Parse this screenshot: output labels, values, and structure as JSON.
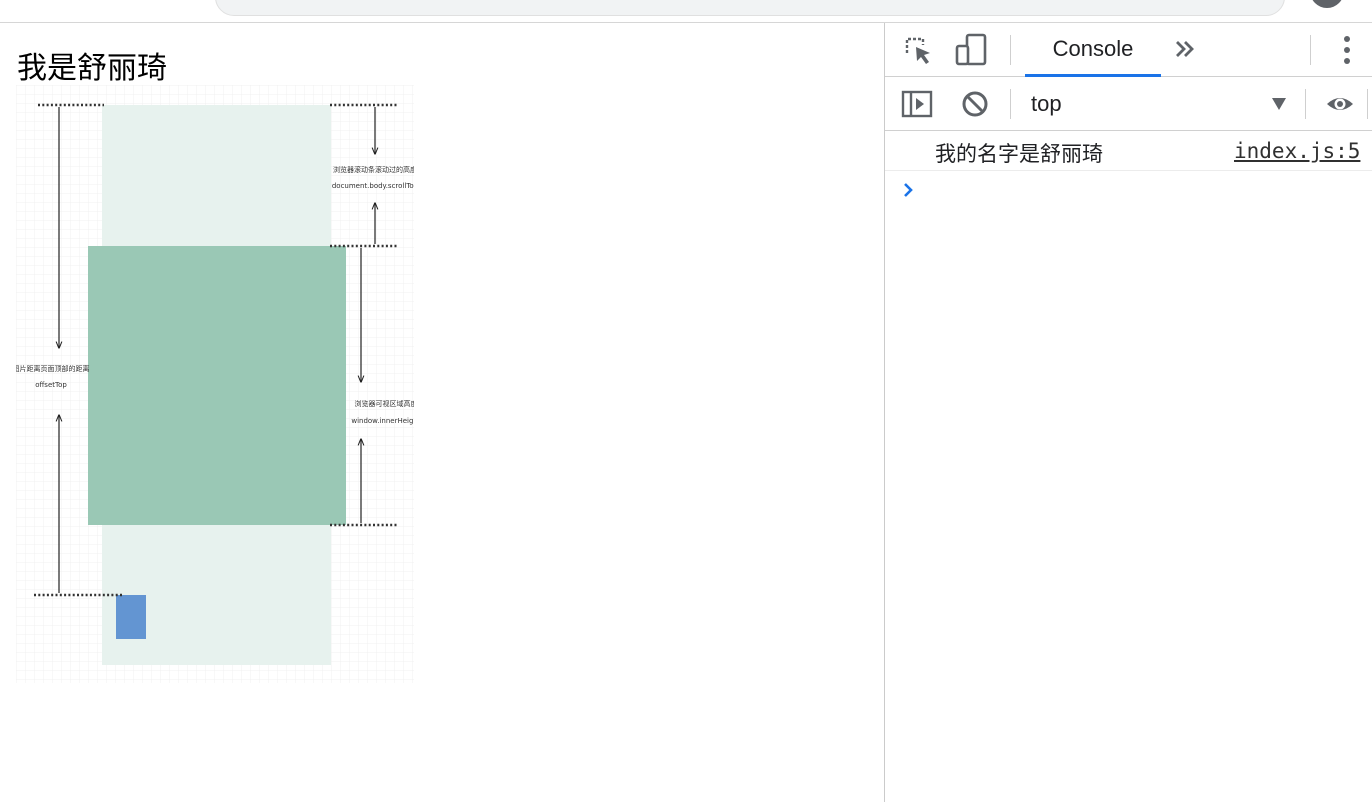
{
  "page": {
    "heading": "我是舒丽琦"
  },
  "diagram": {
    "image_description_icon": "scroll-diagram-illustration",
    "label_offset_top_cn": "图片距离页面顶部的距离",
    "label_offset_top_en": "offsetTop",
    "label_scroll_top_cn": "浏览器滚动条滚动过的高度",
    "label_scroll_top_en": "document.body.scrollTop",
    "label_inner_height_cn": "浏览器可视区域高度",
    "label_inner_height_en": "window.innerHeight",
    "colors": {
      "page_fill": "#e7f2ee",
      "viewport_fill": "#9ac8b5",
      "image_fill": "#6395d2",
      "grid": "#ececec"
    }
  },
  "devtools": {
    "toolbar": {
      "inspect_icon": "element-picker-icon",
      "device_icon": "device-toolbar-icon",
      "active_tab": "Console",
      "more_tabs_icon": "chevron-double-right-icon",
      "menu_icon": "kebab-menu-icon"
    },
    "filterbar": {
      "sidebar_icon": "console-sidebar-icon",
      "clear_icon": "clear-console-icon",
      "context": "top",
      "live_expression_icon": "eye-icon"
    },
    "messages": [
      {
        "text": "我的名字是舒丽琦",
        "source": "index.js:5"
      }
    ],
    "prompt_icon": "chevron-right-icon",
    "accent": "#1a73e8"
  }
}
